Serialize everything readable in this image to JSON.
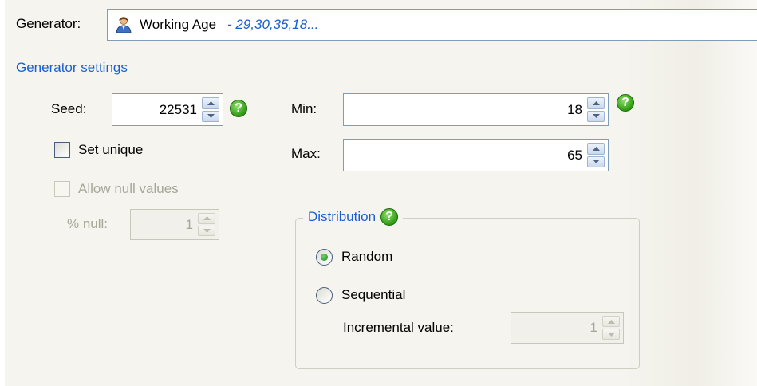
{
  "generator": {
    "label": "Generator:",
    "name": "Working Age",
    "preview": " - 29,30,35,18...",
    "icon": "person-icon"
  },
  "settings": {
    "title": "Generator settings",
    "seed_label": "Seed:",
    "seed_value": "22531",
    "min_label": "Min:",
    "min_value": "18",
    "max_label": "Max:",
    "max_value": "65",
    "set_unique_label": "Set unique",
    "set_unique_checked": false,
    "allow_null_label": "Allow null values",
    "allow_null_checked": false,
    "null_pct_label": "% null:",
    "null_pct_value": "1"
  },
  "distribution": {
    "title": "Distribution",
    "random_label": "Random",
    "random_selected": true,
    "sequential_label": "Sequential",
    "sequential_selected": false,
    "incremental_label": "Incremental value:",
    "incremental_value": "1"
  },
  "colors": {
    "accent_blue": "#1a5fd0",
    "help_green": "#2f9a14",
    "input_border": "#7f9db9",
    "panel_bg": "#f5f4ee"
  }
}
